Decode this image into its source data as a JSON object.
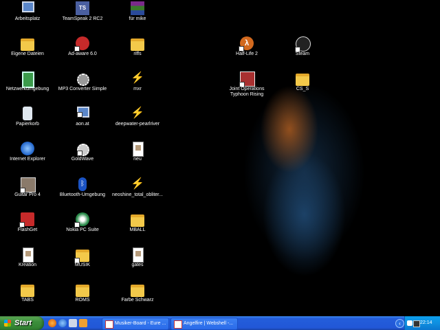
{
  "desktop_icons": [
    {
      "label": "Arbeitsplatz",
      "icon": "my-computer-icon"
    },
    {
      "label": "Eigene Dateien",
      "icon": "my-documents-icon"
    },
    {
      "label": "Netzwerkumgebung",
      "icon": "network-icon"
    },
    {
      "label": "Papierkorb",
      "icon": "recycle-bin-icon"
    },
    {
      "label": "Internet Explorer",
      "icon": "internet-explorer-icon"
    },
    {
      "label": "Guitar Pro 4",
      "icon": "guitar-pro-icon"
    },
    {
      "label": "FlashGet",
      "icon": "flashget-icon"
    },
    {
      "label": "Kreation",
      "icon": "image-file-icon"
    },
    {
      "label": "TABS",
      "icon": "folder-icon"
    },
    {
      "label": "TeamSpeak 2 RC2",
      "icon": "teamspeak-icon"
    },
    {
      "label": "Ad-aware 6.0",
      "icon": "adaware-icon"
    },
    {
      "label": "MP3 Converter Simple",
      "icon": "mp3-converter-icon"
    },
    {
      "label": "aon.at",
      "icon": "aon-icon"
    },
    {
      "label": "GoldWave",
      "icon": "goldwave-icon"
    },
    {
      "label": "Bluetooth-Umgebung",
      "icon": "bluetooth-icon"
    },
    {
      "label": "Nokia PC Suite",
      "icon": "nokia-icon"
    },
    {
      "label": "MUSIK",
      "icon": "folder-icon"
    },
    {
      "label": "ROMS",
      "icon": "folder-icon"
    },
    {
      "label": "für mike",
      "icon": "winrar-icon"
    },
    {
      "label": "riffs",
      "icon": "folder-icon"
    },
    {
      "label": "mxr",
      "icon": "winamp-file-icon"
    },
    {
      "label": "deepwater-pearlriver",
      "icon": "winamp-file-icon"
    },
    {
      "label": "neu",
      "icon": "image-file-icon"
    },
    {
      "label": "neoshine_total_obliter...",
      "icon": "winamp-file-icon"
    },
    {
      "label": "MBALL",
      "icon": "folder-icon"
    },
    {
      "label": "gates",
      "icon": "image-file-icon"
    },
    {
      "label": "Farbe Schwarz",
      "icon": "folder-icon"
    },
    {
      "label": "Half-Life 2",
      "icon": "half-life-icon"
    },
    {
      "label": "Steam",
      "icon": "steam-icon"
    },
    {
      "label": "Joint Operations Typhoon Rising",
      "icon": "joint-operations-icon"
    },
    {
      "label": "CS_S",
      "icon": "folder-icon"
    }
  ],
  "taskbar": {
    "start_label": "Start",
    "tasks": [
      {
        "label": "Musiker-Board - Eure ..."
      },
      {
        "label": "Angelfire | Webshell -..."
      }
    ],
    "clock": "22:14"
  }
}
